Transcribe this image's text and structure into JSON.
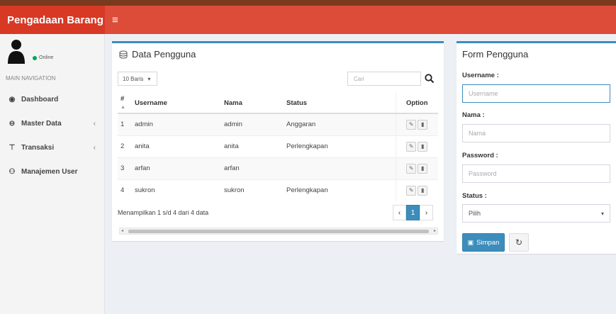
{
  "app": {
    "brand": "Pengadaan Barang",
    "menu_icon": "hamburger-icon"
  },
  "user_panel": {
    "status": "Online"
  },
  "sidebar": {
    "header": "MAIN NAVIGATION",
    "items": [
      {
        "label": "Dashboard",
        "icon": "dashboard-icon",
        "chevron": ""
      },
      {
        "label": "Master Data",
        "icon": "database-icon",
        "chevron": "‹"
      },
      {
        "label": "Transaksi",
        "icon": "cart-icon",
        "chevron": "‹"
      },
      {
        "label": "Manajemen User",
        "icon": "users-icon",
        "chevron": ""
      }
    ]
  },
  "data_box": {
    "title": "Data Pengguna",
    "length_select": "10 Baris",
    "search_placeholder": "Cari",
    "columns": {
      "num": "#",
      "username": "Username",
      "nama": "Nama",
      "status": "Status",
      "option": "Option"
    },
    "rows": [
      {
        "num": "1",
        "username": "admin",
        "nama": "admin",
        "status": "Anggaran"
      },
      {
        "num": "2",
        "username": "anita",
        "nama": "anita",
        "status": "Perlengkapan"
      },
      {
        "num": "3",
        "username": "arfan",
        "nama": "arfan",
        "status": ""
      },
      {
        "num": "4",
        "username": "sukron",
        "nama": "sukron",
        "status": "Perlengkapan"
      }
    ],
    "info": "Menampilkan 1 s/d 4 dari 4 data",
    "pagination": {
      "prev": "‹",
      "current": "1",
      "next": "›"
    }
  },
  "form_box": {
    "title": "Form Pengguna",
    "username": {
      "label": "Username :",
      "placeholder": "Username"
    },
    "nama": {
      "label": "Nama :",
      "placeholder": "Nama"
    },
    "password": {
      "label": "Password :",
      "placeholder": "Password"
    },
    "status": {
      "label": "Status :",
      "value": "Pilih"
    },
    "save_label": "Simpan"
  },
  "colors": {
    "header": "#dd4b39",
    "brand_bg": "#d73925",
    "accent": "#3c8dbc",
    "online": "#00a65a"
  }
}
